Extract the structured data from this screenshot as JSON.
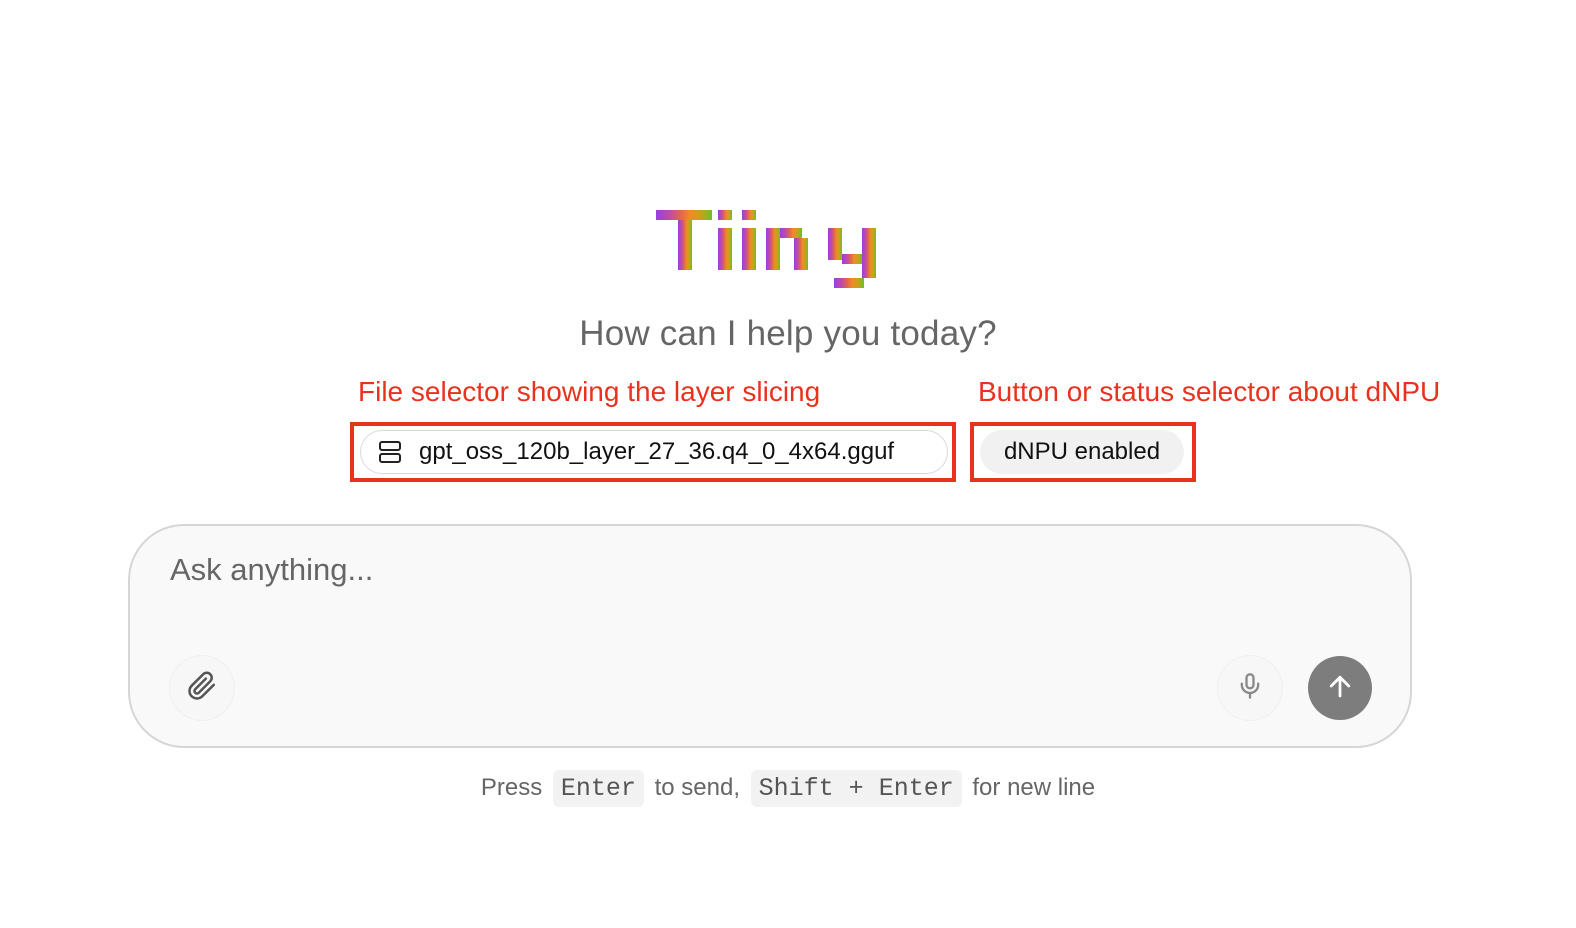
{
  "logo": {
    "text": "Tiiny",
    "colors": [
      "#9b3fe0",
      "#c04aa8",
      "#e06a45",
      "#f08a2a",
      "#c8a21a",
      "#6cbf2a"
    ]
  },
  "greeting": "How can I help you today?",
  "annotations": {
    "file_selector_label": "File selector showing the layer slicing",
    "dnpu_label": "Button or status selector about dNPU",
    "color": "#e8321e"
  },
  "model_chip": {
    "icon": "server-icon",
    "filename": "gpt_oss_120b_layer_27_36.q4_0_4x64.gguf"
  },
  "dnpu_chip": {
    "label": "dNPU enabled"
  },
  "composer": {
    "placeholder": "Ask anything...",
    "attach_icon": "paperclip-icon",
    "mic_icon": "microphone-icon",
    "send_icon": "arrow-up-icon"
  },
  "hint": {
    "press": "Press",
    "key_send": "Enter",
    "to_send": "to send,",
    "key_newline": "Shift + Enter",
    "for_new_line": "for new line"
  }
}
